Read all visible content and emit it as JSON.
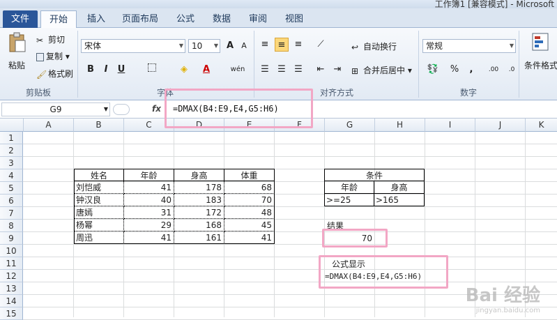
{
  "window": {
    "title": "工作簿1 [兼容模式] - Microsoft"
  },
  "tabs": [
    "文件",
    "开始",
    "插入",
    "页面布局",
    "公式",
    "数据",
    "审阅",
    "视图"
  ],
  "clipboard": {
    "paste": "粘贴",
    "cut": "剪切",
    "copy": "复制",
    "format_painter": "格式刷",
    "group": "剪贴板"
  },
  "font": {
    "name": "宋体",
    "size": "10",
    "group": "字体",
    "bold": "B",
    "italic": "I",
    "underline": "U",
    "grow": "A",
    "shrink": "A",
    "font_color_letter": "A",
    "phonetic": "wén"
  },
  "alignment": {
    "wrap": "自动换行",
    "merge": "合并后居中",
    "group": "对齐方式"
  },
  "number": {
    "format": "常规",
    "percent": "%",
    "comma": ",",
    "increase_dec": ".00",
    "decrease_dec": ".0",
    "group": "数字"
  },
  "styles": {
    "conditional": "条件格式"
  },
  "formula_bar": {
    "cell": "G9",
    "fx": "fx",
    "formula": "=DMAX(B4:E9,E4,G5:H6)"
  },
  "columns": [
    "A",
    "B",
    "C",
    "D",
    "E",
    "F",
    "G",
    "H",
    "I",
    "J",
    "K"
  ],
  "rows": [
    "1",
    "2",
    "3",
    "4",
    "5",
    "6",
    "7",
    "8",
    "9",
    "10",
    "11",
    "12",
    "13",
    "14",
    "15"
  ],
  "table": {
    "headers": [
      "姓名",
      "年龄",
      "身高",
      "体重"
    ],
    "rows": [
      [
        "刘恺威",
        "41",
        "178",
        "68"
      ],
      [
        "钟汉良",
        "40",
        "183",
        "70"
      ],
      [
        "唐嫣",
        "31",
        "172",
        "48"
      ],
      [
        "杨幂",
        "29",
        "168",
        "45"
      ],
      [
        "周迅",
        "41",
        "161",
        "41"
      ]
    ]
  },
  "criteria": {
    "title": "条件",
    "col1": "年龄",
    "col2": "身高",
    "val1": ">=25",
    "val2": ">165"
  },
  "result": {
    "label": "结果",
    "value": "70"
  },
  "formula_display": {
    "label": "公式显示",
    "text": "=DMAX(B4:E9,E4,G5:H6)"
  },
  "watermark": {
    "text": "Bai 经验",
    "url": "jingyan.baidu.com"
  }
}
